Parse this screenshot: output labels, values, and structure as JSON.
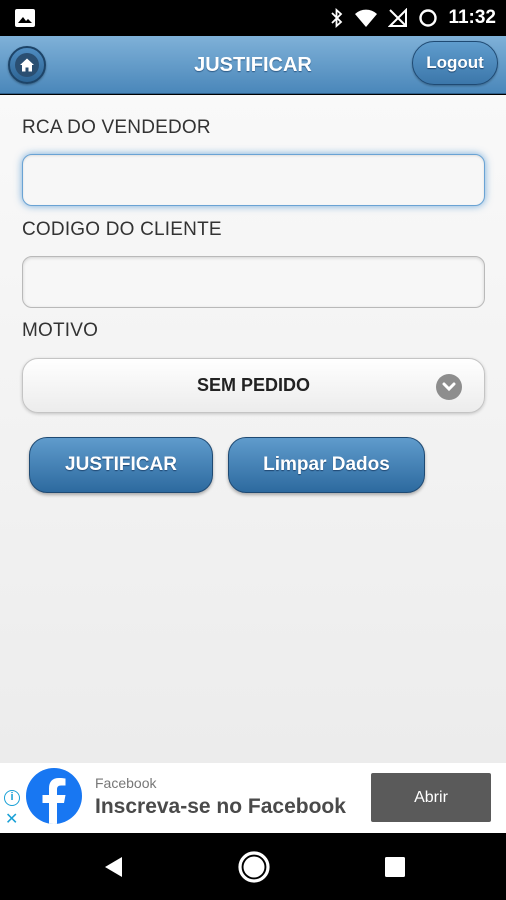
{
  "status_bar": {
    "time": "11:32",
    "icons": [
      "image-icon",
      "bluetooth-icon",
      "wifi-icon",
      "signal-off-icon",
      "sync-icon"
    ]
  },
  "header": {
    "title": "JUSTIFICAR",
    "logout_label": "Logout",
    "home_icon": "home-icon",
    "color": "#4a87ba"
  },
  "form": {
    "rca_label": "RCA DO VENDEDOR",
    "rca_value": "",
    "cliente_label": "CODIGO DO CLIENTE",
    "cliente_value": "",
    "motivo_label": "MOTIVO",
    "motivo_selected": "SEM PEDIDO"
  },
  "actions": {
    "justificar_label": "JUSTIFICAR",
    "limpar_label": "Limpar Dados"
  },
  "ad": {
    "advertiser": "Facebook",
    "title": "Inscreva-se no Facebook",
    "cta": "Abrir",
    "brand_color": "#1877f2"
  },
  "navigation": {
    "icons": [
      "back-icon",
      "home-circle-icon",
      "recents-icon"
    ]
  }
}
